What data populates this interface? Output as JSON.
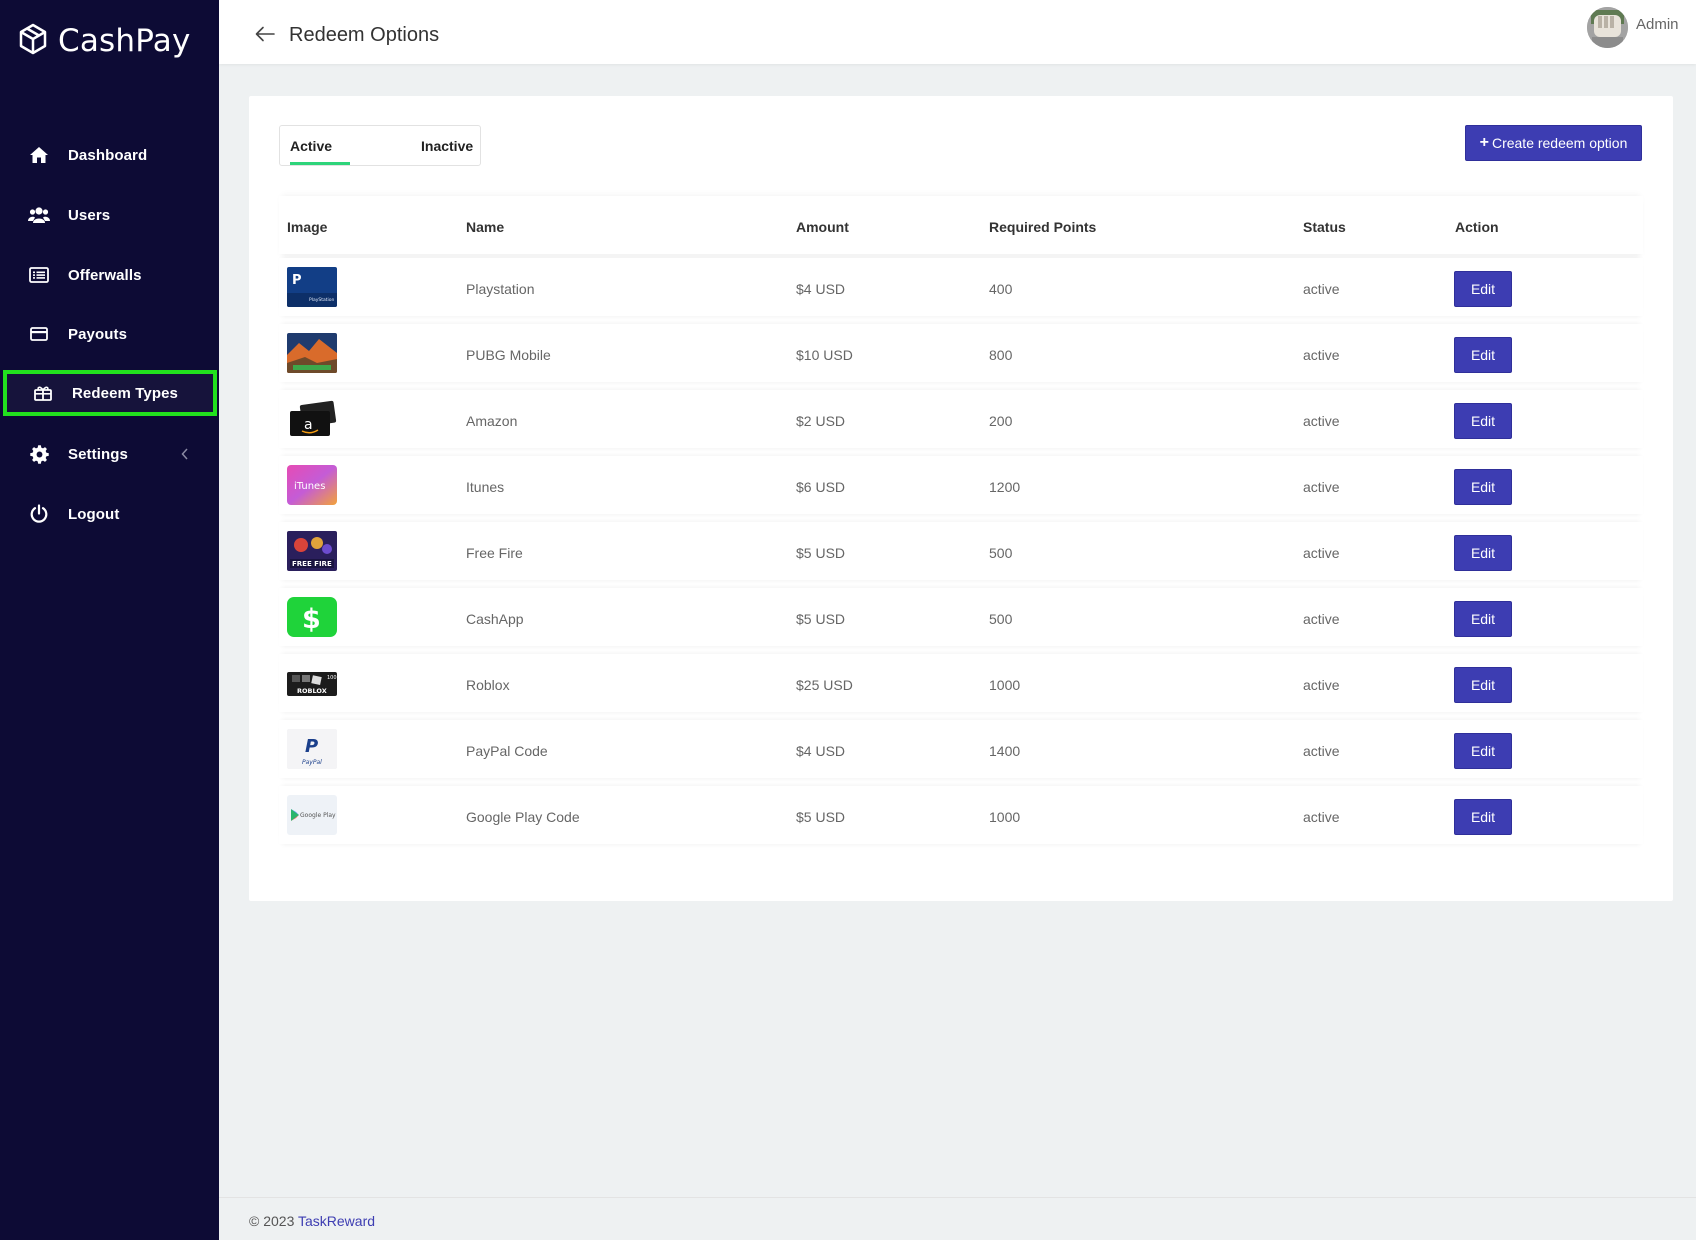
{
  "brand": {
    "name": "CashPay"
  },
  "sidebar": {
    "items": [
      {
        "label": "Dashboard",
        "icon": "home-icon"
      },
      {
        "label": "Users",
        "icon": "users-icon"
      },
      {
        "label": "Offerwalls",
        "icon": "list-icon"
      },
      {
        "label": "Payouts",
        "icon": "credit-card-icon"
      },
      {
        "label": "Redeem Types",
        "icon": "gift-icon",
        "active": true
      },
      {
        "label": "Settings",
        "icon": "gear-icon",
        "has_submenu": true
      },
      {
        "label": "Logout",
        "icon": "power-icon"
      }
    ],
    "active_highlight_color": "#22e11e"
  },
  "header": {
    "title": "Redeem Options",
    "user_label": "Admin"
  },
  "tabs": {
    "active_label": "Active",
    "inactive_label": "Inactive",
    "selected": "Active"
  },
  "toolbar": {
    "create_label": "Create redeem option",
    "create_icon": "plus-icon"
  },
  "table": {
    "columns": [
      "Image",
      "Name",
      "Amount",
      "Required Points",
      "Status",
      "Action"
    ],
    "rows": [
      {
        "image": "playstation-logo",
        "name": "Playstation",
        "amount": "$4 USD",
        "points": "400",
        "status": "active",
        "action": "Edit"
      },
      {
        "image": "pubg-mobile-logo",
        "name": "PUBG Mobile",
        "amount": "$10 USD",
        "points": "800",
        "status": "active",
        "action": "Edit"
      },
      {
        "image": "amazon-logo",
        "name": "Amazon",
        "amount": "$2 USD",
        "points": "200",
        "status": "active",
        "action": "Edit"
      },
      {
        "image": "itunes-logo",
        "name": "Itunes",
        "amount": "$6 USD",
        "points": "1200",
        "status": "active",
        "action": "Edit"
      },
      {
        "image": "free-fire-logo",
        "name": "Free Fire",
        "amount": "$5 USD",
        "points": "500",
        "status": "active",
        "action": "Edit"
      },
      {
        "image": "cashapp-logo",
        "name": "CashApp",
        "amount": "$5 USD",
        "points": "500",
        "status": "active",
        "action": "Edit"
      },
      {
        "image": "roblox-logo",
        "name": "Roblox",
        "amount": "$25 USD",
        "points": "1000",
        "status": "active",
        "action": "Edit"
      },
      {
        "image": "paypal-logo",
        "name": "PayPal Code",
        "amount": "$4 USD",
        "points": "1400",
        "status": "active",
        "action": "Edit"
      },
      {
        "image": "google-play-logo",
        "name": "Google Play Code",
        "amount": "$5 USD",
        "points": "1000",
        "status": "active",
        "action": "Edit"
      }
    ]
  },
  "footer": {
    "copyright": "© 2023",
    "link_text": "TaskReward"
  },
  "colors": {
    "sidebar_bg": "#0d0b35",
    "primary_button": "#3d3db2",
    "tab_underline": "#2ed47a",
    "page_bg": "#eef1f2"
  }
}
